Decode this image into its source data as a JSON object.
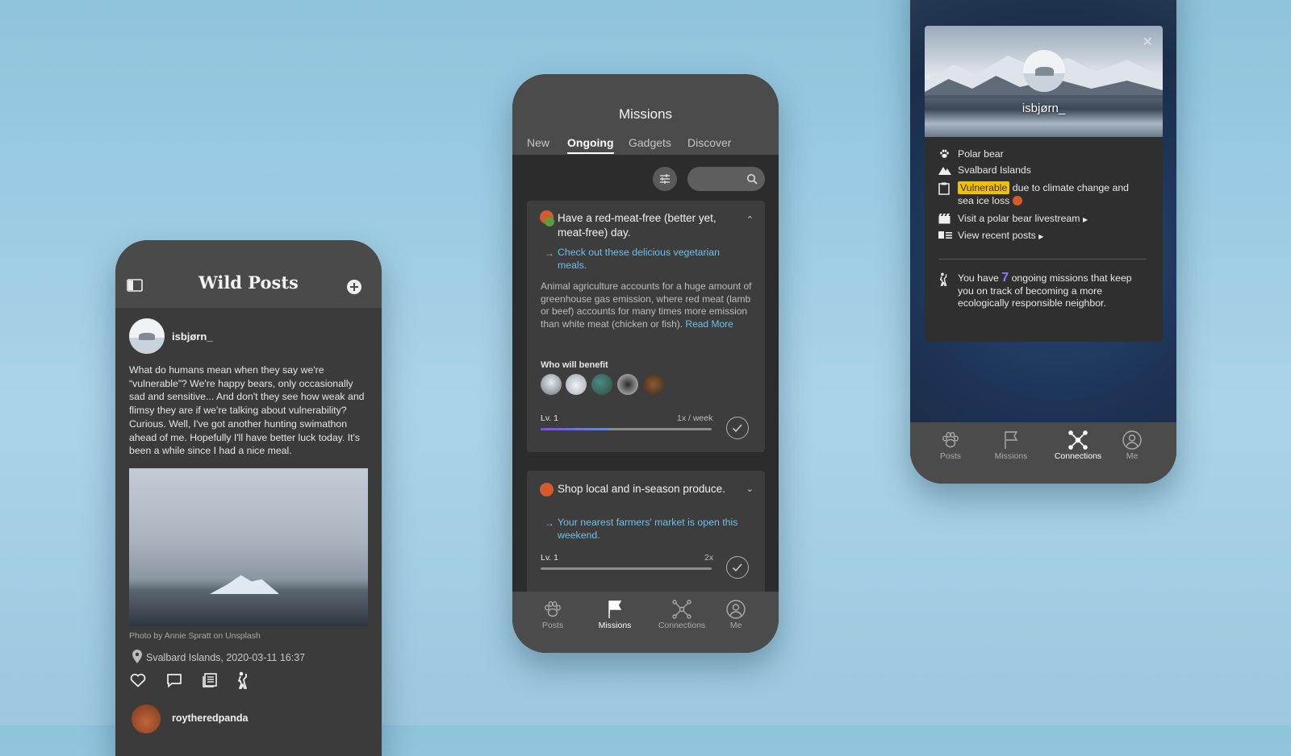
{
  "wild_posts": {
    "title": "Wild Posts",
    "post": {
      "username": "isbjørn_",
      "body": "What do humans mean when they say we're “vulnerable”? We're happy bears, only occasionally sad and sensitive... And don't they see how weak and flimsy they are if we're talking about vulnerability? Curious. Well, I've got another hunting swimathon ahead of me. Hopefully I'll have better luck today. It's been a while since I had a nice meal.",
      "photo_credit": "Photo by Annie Spratt on Unsplash",
      "location": "Svalbard Islands, 2020-03-11 16:37"
    },
    "next_post_username": "roytheredpanda"
  },
  "missions": {
    "title": "Missions",
    "tabs": [
      {
        "label": "New"
      },
      {
        "label": "Ongoing"
      },
      {
        "label": "Gadgets"
      },
      {
        "label": "Discover"
      }
    ],
    "active_tab": "Ongoing",
    "cards": [
      {
        "title": "Have a red-meat-free (better yet, meat-free) day.",
        "link": "Check out these delicious vegetarian meals.",
        "description": "Animal agriculture accounts for a huge amount of greenhouse gas emission, where red meat (lamb or beef) accounts for many times more emission than white meat (chicken or fish).",
        "read_more": "Read More",
        "who_benefit_label": "Who will benefit",
        "level": "Lv. 1",
        "frequency": "1x / week",
        "progress": 0.4
      },
      {
        "title": "Shop local and in-season produce.",
        "link": "Your nearest farmers' market is open this weekend.",
        "level": "Lv. 1",
        "frequency": "2x",
        "progress": 0.0
      }
    ]
  },
  "nav": {
    "items": [
      {
        "label": "Posts",
        "icon": "paw-icon"
      },
      {
        "label": "Missions",
        "icon": "flag-icon"
      },
      {
        "label": "Connections",
        "icon": "connections-icon"
      },
      {
        "label": "Me",
        "icon": "user-icon"
      }
    ]
  },
  "profile": {
    "name": "isbjørn_",
    "species": "Polar bear",
    "location": "Svalbard Islands",
    "status_badge": "Vulnerable",
    "status_text": "due to climate change and sea ice loss",
    "livestream_link": "Visit a polar bear livestream",
    "recent_posts_link": "View recent posts",
    "missions_prefix": "You have",
    "missions_count": "7",
    "missions_suffix": "ongoing missions that keep you on track of becoming a more ecologically responsible neighbor."
  },
  "colors": {
    "accent_link": "#6fc0e8",
    "progress_start": "#7c4cf0",
    "progress_end": "#5a8cf0",
    "vulnerable_badge": "#f2c200",
    "count_highlight": "#8f7bff"
  }
}
